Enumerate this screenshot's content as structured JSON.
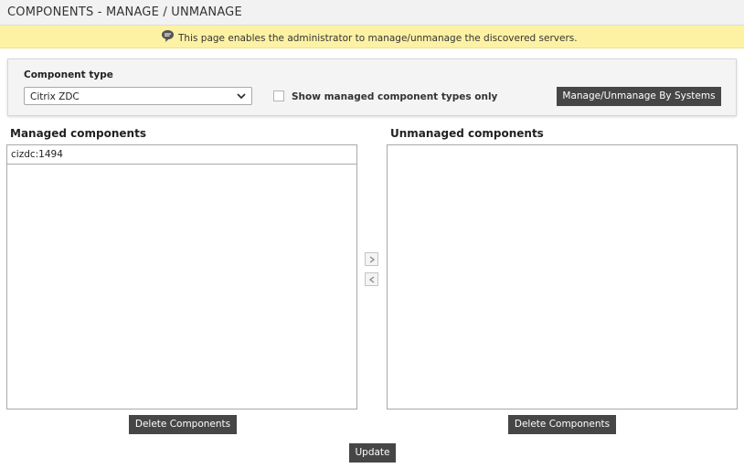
{
  "page": {
    "title": "COMPONENTS - MANAGE / UNMANAGE"
  },
  "info": {
    "icon": "speech-bubble-icon",
    "message": "This page enables the administrator to manage/unmanage the discovered servers."
  },
  "filter": {
    "component_type_label": "Component type",
    "component_type_value": "Citrix ZDC",
    "show_managed_only_label": "Show managed component types only",
    "show_managed_only_checked": false,
    "manage_by_systems_label": "Manage/Unmanage By Systems"
  },
  "managed": {
    "title": "Managed components",
    "items": [
      "cizdc:1494"
    ],
    "delete_label": "Delete Components"
  },
  "unmanaged": {
    "title": "Unmanaged components",
    "items": [],
    "delete_label": "Delete Components"
  },
  "actions": {
    "update_label": "Update",
    "move_right_icon": "chevron-right-icon",
    "move_left_icon": "chevron-left-icon"
  },
  "colors": {
    "info_bar": "#fdf2a4",
    "dark_button": "#464646"
  }
}
